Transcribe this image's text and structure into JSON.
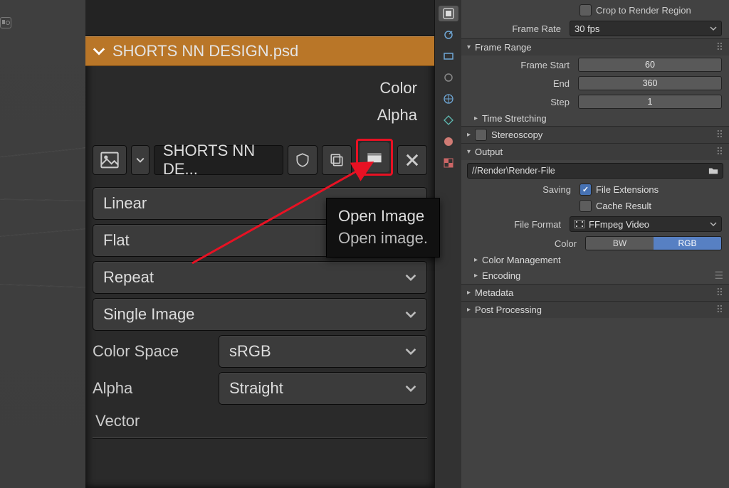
{
  "node": {
    "title": "SHORTS NN DESIGN.psd",
    "outputs": [
      "Color",
      "Alpha"
    ],
    "image_name": "SHORTS NN DE...",
    "options": {
      "interpolation": "Linear",
      "projection": "Flat",
      "extension": "Repeat",
      "source": "Single Image",
      "color_space_label": "Color Space",
      "color_space": "sRGB",
      "alpha_label": "Alpha",
      "alpha": "Straight",
      "vector": "Vector"
    }
  },
  "tooltip": {
    "title": "Open Image",
    "desc": "Open image."
  },
  "right": {
    "crop": "Crop to Render Region",
    "frame_rate_label": "Frame Rate",
    "frame_rate": "30 fps",
    "sections": {
      "frame_range": "Frame Range",
      "frame_start_label": "Frame Start",
      "frame_start": "60",
      "end_label": "End",
      "end": "360",
      "step_label": "Step",
      "step": "1",
      "time_stretch": "Time Stretching",
      "stereo": "Stereoscopy",
      "output": "Output",
      "output_path": "//Render\\Render-File",
      "saving_label": "Saving",
      "file_ext": "File Extensions",
      "cache": "Cache Result",
      "file_format_label": "File Format",
      "file_format": "FFmpeg Video",
      "color_label": "Color",
      "bw": "BW",
      "rgb": "RGB",
      "color_mgmt": "Color Management",
      "encoding": "Encoding",
      "metadata": "Metadata",
      "post": "Post Processing"
    }
  }
}
